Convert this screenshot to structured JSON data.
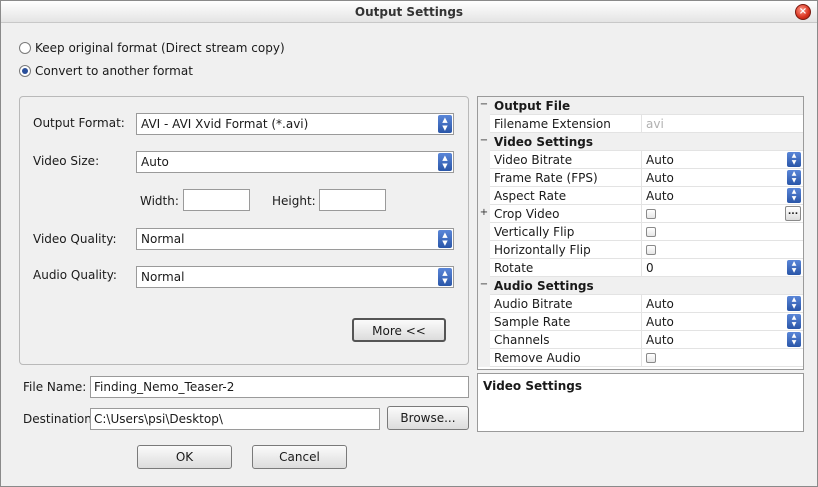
{
  "window": {
    "title": "Output Settings",
    "close_glyph": "×"
  },
  "mode": {
    "keep_label": "Keep original format (Direct stream copy)",
    "convert_label": "Convert to another format"
  },
  "format": {
    "output_format_label": "Output Format:",
    "output_format_value": "AVI - AVI Xvid Format (*.avi)",
    "video_size_label": "Video Size:",
    "video_size_value": "Auto",
    "width_label": "Width:",
    "width_value": "",
    "height_label": "Height:",
    "height_value": "",
    "video_quality_label": "Video Quality:",
    "video_quality_value": "Normal",
    "audio_quality_label": "Audio Quality:",
    "audio_quality_value": "Normal",
    "more_label": "More <<"
  },
  "file": {
    "name_label": "File Name:",
    "name_value": "Finding_Nemo_Teaser-2",
    "dest_label": "Destination:",
    "dest_value": "C:\\Users\\psi\\Desktop\\",
    "browse_label": "Browse..."
  },
  "buttons": {
    "ok": "OK",
    "cancel": "Cancel"
  },
  "properties": {
    "output_file": {
      "title": "Output File",
      "filename_ext_label": "Filename Extension",
      "filename_ext_value": "avi"
    },
    "video": {
      "title": "Video Settings",
      "bitrate_label": "Video Bitrate",
      "bitrate_value": "Auto",
      "fps_label": "Frame Rate (FPS)",
      "fps_value": "Auto",
      "aspect_label": "Aspect Rate",
      "aspect_value": "Auto",
      "crop_label": "Crop Video",
      "vflip_label": "Vertically Flip",
      "hflip_label": "Horizontally Flip",
      "rotate_label": "Rotate",
      "rotate_value": "0"
    },
    "audio": {
      "title": "Audio Settings",
      "bitrate_label": "Audio Bitrate",
      "bitrate_value": "Auto",
      "sample_label": "Sample Rate",
      "sample_value": "Auto",
      "channels_label": "Channels",
      "channels_value": "Auto",
      "remove_label": "Remove Audio"
    },
    "collapse_glyph": "−",
    "expand_glyph": "+",
    "ellipsis_glyph": "..."
  },
  "description": {
    "title": "Video Settings"
  },
  "colors": {
    "accent": "#2a56a8",
    "window_bg": "#f0f0f0",
    "close": "#d8321e"
  }
}
